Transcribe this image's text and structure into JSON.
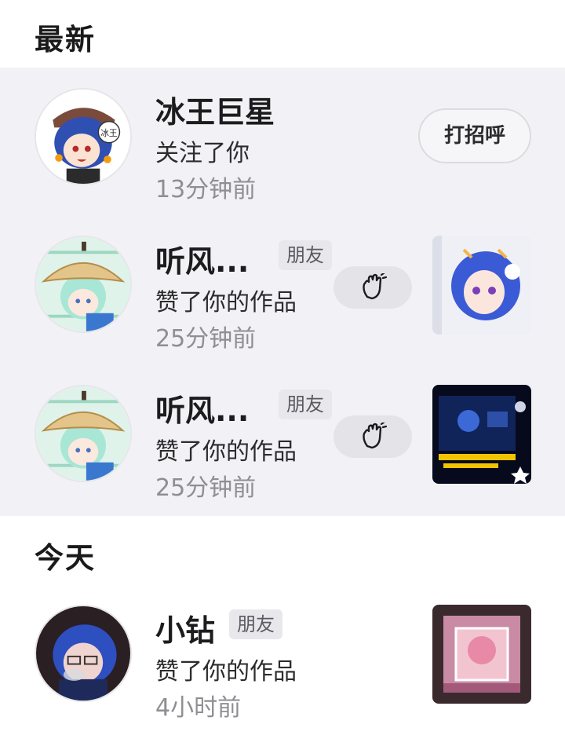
{
  "sections": {
    "latest": "最新",
    "today": "今天"
  },
  "notifications": [
    {
      "name": "冰王巨星",
      "action": "关注了你",
      "time": "13分钟前",
      "button": "打招呼"
    },
    {
      "name": "听风...",
      "tag": "朋友",
      "action": "赞了你的作品",
      "time": "25分钟前",
      "button_icon": "wave-hand-icon"
    },
    {
      "name": "听风...",
      "tag": "朋友",
      "action": "赞了你的作品",
      "time": "25分钟前",
      "button_icon": "wave-hand-icon"
    }
  ],
  "today": [
    {
      "name": "小钻",
      "tag": "朋友",
      "action": "赞了你的作品",
      "time": "4小时前"
    }
  ],
  "avatar_badge": "冰王",
  "colors": {
    "section_bg": "#f2f2f6",
    "secondary_text": "#8e8e93",
    "tag_bg": "#e8e8ec"
  }
}
